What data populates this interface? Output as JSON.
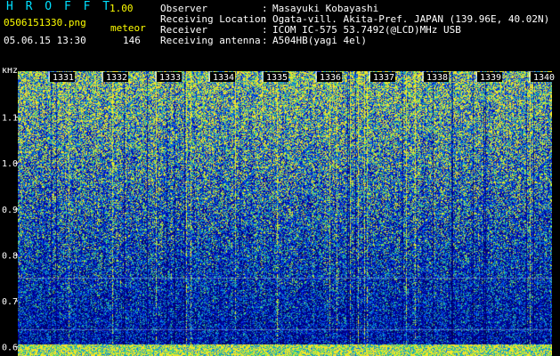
{
  "header": {
    "app_title": "H R O F F T",
    "app_version": "1.00",
    "filename": "0506151330.png",
    "datetime": "05.06.15 13:30",
    "meteor_label": "meteor",
    "meteor_count": "146"
  },
  "info": [
    {
      "label": "Observer",
      "value": "Masayuki Kobayashi"
    },
    {
      "label": "Receiving Location",
      "value": "Ogata-vill. Akita-Pref. JAPAN (139.96E, 40.02N)"
    },
    {
      "label": "Receiver",
      "value": "ICOM IC-575 53.7492(@LCD)MHz USB"
    },
    {
      "label": "Receiving antenna",
      "value": "A504HB(yagi 4el)"
    }
  ],
  "colors": {
    "background": "#000000",
    "spectrum_low": "#00006e",
    "spectrum_mid": "#0080ff",
    "spectrum_high": "#ffff00",
    "axis_text": "#ffffff",
    "time_label": "#ffff00"
  },
  "chart_data": {
    "type": "heatmap",
    "ylabel": "kHz",
    "y_ticks": [
      "1.1",
      "1.0",
      "0.9",
      "0.8",
      "0.7",
      "0.6"
    ],
    "ylim": [
      0.58,
      1.2
    ],
    "time_labels": [
      "1331",
      "1332",
      "1333",
      "1334",
      "1335",
      "1336",
      "1337",
      "1338",
      "1339",
      "1340"
    ],
    "grid": false
  }
}
